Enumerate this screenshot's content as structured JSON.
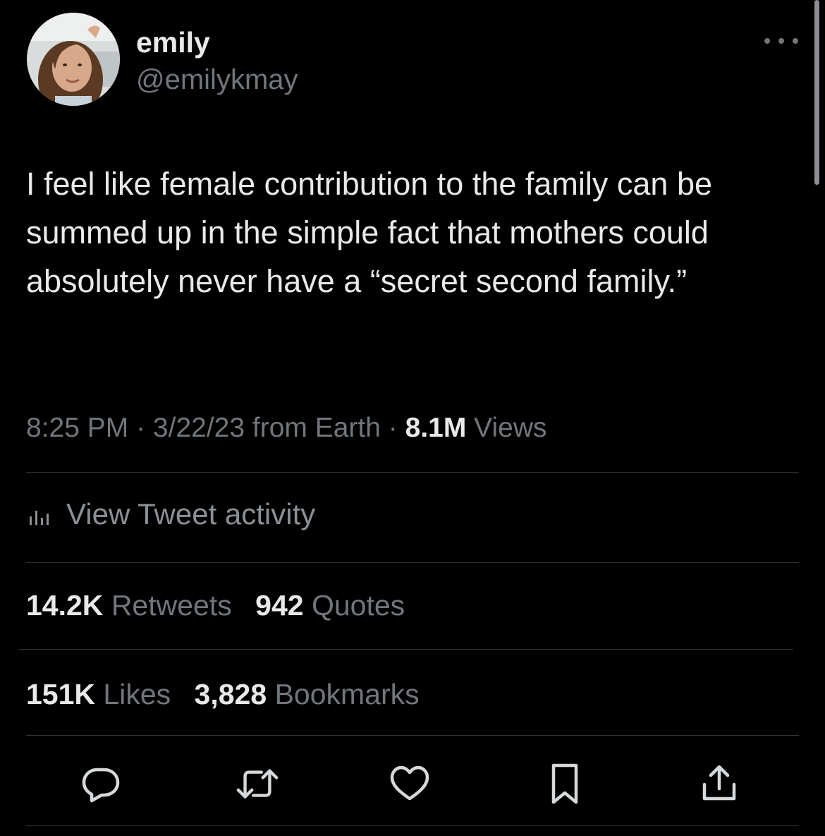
{
  "author": {
    "display_name": "emily",
    "handle": "@emilykmay"
  },
  "tweet": {
    "text": "I feel like female contribution to the family can be summed up in the simple fact that mothers could absolutely never have a “secret second family.”",
    "time": "8:25 PM",
    "date": "3/22/23",
    "source": "from Earth",
    "separator": " · ",
    "views_count": "8.1M",
    "views_label": "Views"
  },
  "activity": {
    "label": "View Tweet activity",
    "icon": "bar-chart-icon"
  },
  "stats": {
    "retweets": {
      "count": "14.2K",
      "label": "Retweets"
    },
    "quotes": {
      "count": "942",
      "label": "Quotes"
    },
    "likes": {
      "count": "151K",
      "label": "Likes"
    },
    "bookmarks": {
      "count": "3,828",
      "label": "Bookmarks"
    }
  },
  "actions": [
    {
      "name": "reply",
      "icon": "reply-bubble-icon"
    },
    {
      "name": "retweet",
      "icon": "retweet-icon"
    },
    {
      "name": "like",
      "icon": "heart-icon"
    },
    {
      "name": "bookmark",
      "icon": "bookmark-icon"
    },
    {
      "name": "share",
      "icon": "share-icon"
    }
  ],
  "colors": {
    "background": "#000000",
    "primary_text": "#e7e9ea",
    "secondary_text": "#71767b",
    "divider": "#2f3336"
  }
}
